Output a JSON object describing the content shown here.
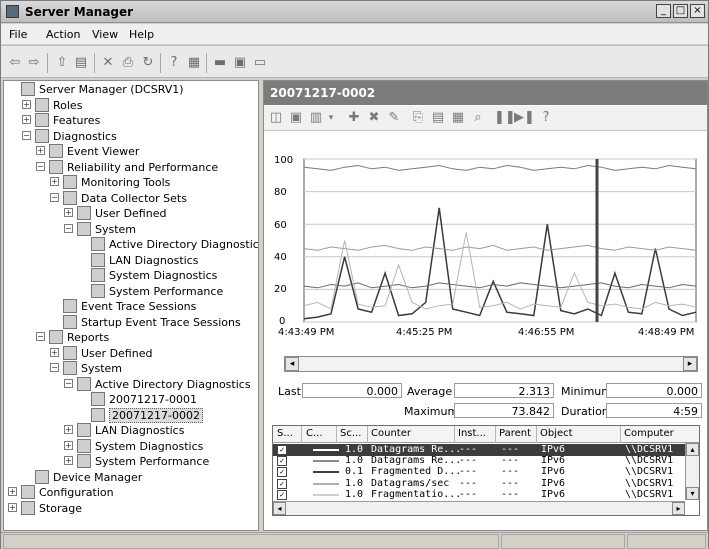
{
  "window": {
    "title": "Server Manager",
    "controls": {
      "minimize": "_",
      "maximize": "□",
      "close": "×"
    }
  },
  "menu": [
    "File",
    "Action",
    "View",
    "Help"
  ],
  "tree": [
    {
      "label": "Server Manager (DCSRV1)",
      "icon": "server-icon",
      "expander": ""
    },
    {
      "label": "Roles",
      "icon": "roles-icon",
      "expander": "+"
    },
    {
      "label": "Features",
      "icon": "features-icon",
      "expander": "+"
    },
    {
      "label": "Diagnostics",
      "icon": "diagnostics-icon",
      "expander": "−"
    },
    {
      "label": "Event Viewer",
      "icon": "event-viewer-icon",
      "expander": "+"
    },
    {
      "label": "Reliability and Performance",
      "icon": "gauge-icon",
      "expander": "−"
    },
    {
      "label": "Monitoring Tools",
      "icon": "monitor-icon",
      "expander": "+"
    },
    {
      "label": "Data Collector Sets",
      "icon": "data-collector-icon",
      "expander": "−"
    },
    {
      "label": "User Defined",
      "icon": "folder-icon",
      "expander": "+"
    },
    {
      "label": "System",
      "icon": "folder-icon",
      "expander": "−"
    },
    {
      "label": "Active Directory Diagnostics",
      "icon": "collector-set-icon",
      "expander": ""
    },
    {
      "label": "LAN Diagnostics",
      "icon": "collector-set-icon",
      "expander": ""
    },
    {
      "label": "System Diagnostics",
      "icon": "collector-set-icon",
      "expander": ""
    },
    {
      "label": "System Performance",
      "icon": "collector-set-icon",
      "expander": ""
    },
    {
      "label": "Event Trace Sessions",
      "icon": "trace-icon",
      "expander": ""
    },
    {
      "label": "Startup Event Trace Sessions",
      "icon": "trace-icon",
      "expander": ""
    },
    {
      "label": "Reports",
      "icon": "reports-icon",
      "expander": "−"
    },
    {
      "label": "User Defined",
      "icon": "report-folder-icon",
      "expander": "+"
    },
    {
      "label": "System",
      "icon": "report-folder-icon",
      "expander": "−"
    },
    {
      "label": "Active Directory Diagnostics",
      "icon": "report-folder-icon",
      "expander": "−"
    },
    {
      "label": "20071217-0001",
      "icon": "report-icon",
      "expander": ""
    },
    {
      "label": "20071217-0002",
      "icon": "report-icon",
      "expander": "",
      "selected": true
    },
    {
      "label": "LAN Diagnostics",
      "icon": "report-folder-icon",
      "expander": "+"
    },
    {
      "label": "System Diagnostics",
      "icon": "report-folder-icon",
      "expander": "+"
    },
    {
      "label": "System Performance",
      "icon": "report-folder-icon",
      "expander": "+"
    },
    {
      "label": "Device Manager",
      "icon": "device-manager-icon",
      "expander": ""
    },
    {
      "label": "Configuration",
      "icon": "configuration-icon",
      "expander": "+"
    },
    {
      "label": "Storage",
      "icon": "storage-icon",
      "expander": "+"
    }
  ],
  "report": {
    "title": "20071217-0002",
    "stats": {
      "last_label": "Last",
      "last": "0.000",
      "average_label": "Average",
      "average": "2.313",
      "minimum_label": "Minimum",
      "minimum": "0.000",
      "maximum_label": "Maximum",
      "maximum": "73.842",
      "duration_label": "Duration",
      "duration": "4:59"
    },
    "columns": [
      "S...",
      "C...",
      "Sc...",
      "Counter",
      "Inst...",
      "Parent",
      "Object",
      "Computer"
    ],
    "rows": [
      {
        "scale": "1.0",
        "counter": "Datagrams Re...",
        "instance": "---",
        "parent": "---",
        "object": "IPv6",
        "computer": "\\\\DCSRV1",
        "selected": true,
        "color": "#ffffff"
      },
      {
        "scale": "1.0",
        "counter": "Datagrams Re...",
        "instance": "---",
        "parent": "---",
        "object": "IPv6",
        "computer": "\\\\DCSRV1",
        "color": "#8a8a8a"
      },
      {
        "scale": "0.1",
        "counter": "Fragmented D...",
        "instance": "---",
        "parent": "---",
        "object": "IPv6",
        "computer": "\\\\DCSRV1",
        "color": "#404040"
      },
      {
        "scale": "1.0",
        "counter": "Datagrams/sec",
        "instance": "---",
        "parent": "---",
        "object": "IPv6",
        "computer": "\\\\DCSRV1",
        "color": "#b0b0b0"
      },
      {
        "scale": "1.0",
        "counter": "Fragmentatio...",
        "instance": "---",
        "parent": "---",
        "object": "IPv6",
        "computer": "\\\\DCSRV1",
        "color": "#cfcfcf"
      }
    ]
  },
  "chart_data": {
    "type": "line",
    "ylim": [
      0,
      100
    ],
    "y_ticks": [
      0,
      20,
      40,
      60,
      80,
      100
    ],
    "x_tick_labels": [
      "4:43:49 PM",
      "4:45:25 PM",
      "4:46:55 PM",
      "4:48:49 PM"
    ],
    "grid": true,
    "series": [
      {
        "values": [
          2,
          3,
          5,
          40,
          8,
          6,
          30,
          4,
          5,
          12,
          70,
          8,
          6,
          4,
          25,
          6,
          5,
          4,
          60,
          7,
          5,
          8,
          4,
          30,
          6,
          5,
          45,
          8,
          4,
          6
        ]
      },
      {
        "values": [
          45,
          44,
          46,
          45,
          44,
          46,
          47,
          45,
          44,
          46,
          45,
          44,
          46,
          45,
          47,
          44,
          45,
          46,
          44,
          45,
          46,
          47,
          45,
          44,
          46,
          45,
          44,
          46,
          45,
          44
        ]
      },
      {
        "values": [
          22,
          21,
          23,
          22,
          24,
          21,
          22,
          23,
          21,
          22,
          24,
          23,
          22,
          21,
          23,
          22,
          24,
          23,
          22,
          21,
          22,
          23,
          24,
          22,
          21,
          23,
          22,
          21,
          23,
          22
        ]
      },
      {
        "values": [
          95,
          94,
          93,
          95,
          96,
          94,
          95,
          93,
          94,
          95,
          96,
          94,
          93,
          95,
          94,
          96,
          95,
          93,
          94,
          95,
          94,
          96,
          95,
          93,
          94,
          95,
          94,
          96,
          95,
          94
        ]
      },
      {
        "values": [
          10,
          12,
          8,
          50,
          11,
          9,
          10,
          35,
          12,
          8,
          10,
          11,
          55,
          9,
          10,
          12,
          8,
          11,
          10,
          9,
          30,
          12,
          10,
          11,
          9,
          8,
          12,
          10,
          11,
          9
        ]
      }
    ]
  }
}
